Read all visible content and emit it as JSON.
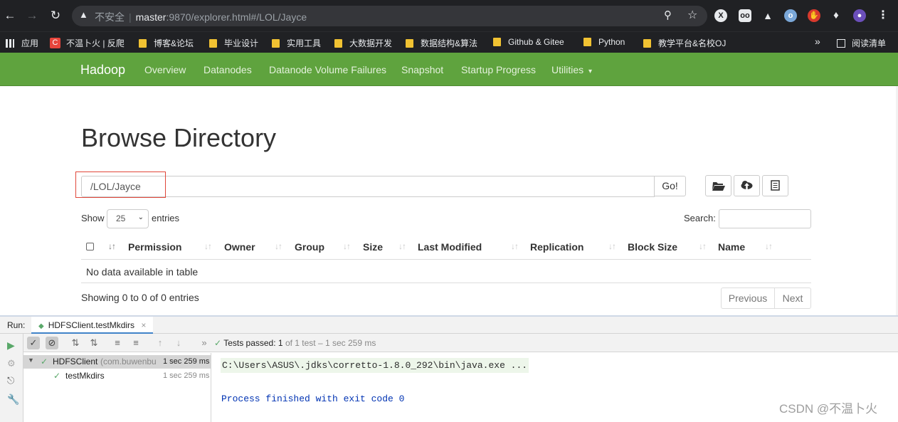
{
  "browser": {
    "security_label": "不安全",
    "url_host": "master",
    "url_path": ":9870/explorer.html#/LOL/Jayce",
    "back_icon": "arrow-left-icon",
    "forward_icon": "arrow-right-icon",
    "reload_icon": "reload-icon"
  },
  "bookmarks": {
    "items": [
      {
        "label": "应用"
      },
      {
        "label": "不温卜火 | 反爬"
      },
      {
        "label": "博客&论坛"
      },
      {
        "label": "毕业设计"
      },
      {
        "label": "实用工具"
      },
      {
        "label": "大数据开发"
      },
      {
        "label": "数据结构&算法"
      },
      {
        "label": "Github & Gitee"
      },
      {
        "label": "Python"
      },
      {
        "label": "教学平台&名校OJ"
      }
    ],
    "more": "»",
    "reading_list": "阅读清单"
  },
  "hadoop_nav": {
    "brand": "Hadoop",
    "items": [
      "Overview",
      "Datanodes",
      "Datanode Volume Failures",
      "Snapshot",
      "Startup Progress",
      "Utilities"
    ],
    "dropdown_caret": "▾"
  },
  "browse": {
    "title": "Browse Directory",
    "path_value": "/LOL/Jayce",
    "go_label": "Go!",
    "show_label": "Show",
    "entries_label": "entries",
    "page_size": "25",
    "search_label": "Search:",
    "columns": [
      "Permission",
      "Owner",
      "Group",
      "Size",
      "Last Modified",
      "Replication",
      "Block Size",
      "Name"
    ],
    "no_data": "No data available in table",
    "showing": "Showing 0 to 0 of 0 entries",
    "previous": "Previous",
    "next": "Next"
  },
  "ide": {
    "run_label": "Run:",
    "tab_label": "HDFSClient.testMkdirs",
    "tests_passed_label": "Tests passed:",
    "tests_passed_count": "1",
    "tests_summary": "of 1 test – 1 sec 259 ms",
    "tree": [
      {
        "name": "HDFSClient",
        "package": "(com.buwenbu",
        "time": "1 sec 259 ms"
      },
      {
        "name": "testMkdirs",
        "package": "",
        "time": "1 sec 259 ms"
      }
    ],
    "console_lines": [
      "C:\\Users\\ASUS\\.jdks\\corretto-1.8.0_292\\bin\\java.exe ...",
      "Process finished with exit code 0"
    ]
  },
  "watermark": "CSDN @不温卜火",
  "colors": {
    "hadoop_green": "#5fa33e",
    "highlight_red": "#e0473a",
    "pass_green": "#59a869"
  }
}
